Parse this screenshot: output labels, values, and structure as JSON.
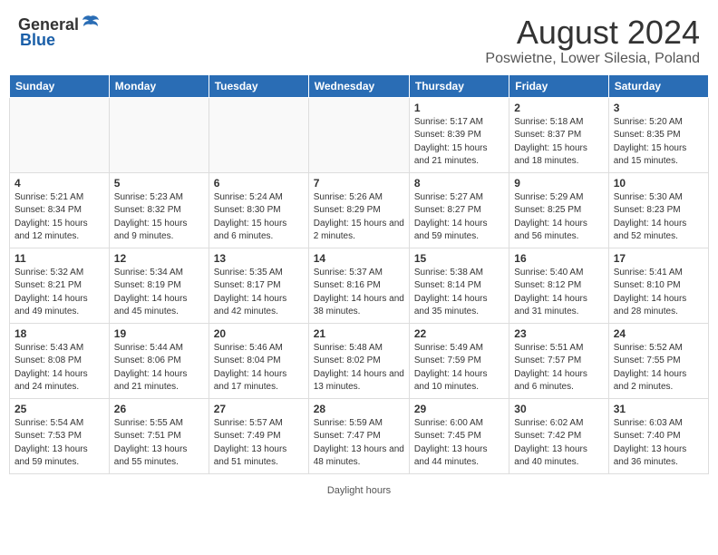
{
  "header": {
    "logo_general": "General",
    "logo_blue": "Blue",
    "title": "August 2024",
    "location": "Poswietne, Lower Silesia, Poland"
  },
  "days_of_week": [
    "Sunday",
    "Monday",
    "Tuesday",
    "Wednesday",
    "Thursday",
    "Friday",
    "Saturday"
  ],
  "footer": {
    "daylight_label": "Daylight hours"
  },
  "weeks": [
    [
      {
        "day": "",
        "sunrise": "",
        "sunset": "",
        "daylight": "",
        "empty": true
      },
      {
        "day": "",
        "sunrise": "",
        "sunset": "",
        "daylight": "",
        "empty": true
      },
      {
        "day": "",
        "sunrise": "",
        "sunset": "",
        "daylight": "",
        "empty": true
      },
      {
        "day": "",
        "sunrise": "",
        "sunset": "",
        "daylight": "",
        "empty": true
      },
      {
        "day": "1",
        "sunrise": "Sunrise: 5:17 AM",
        "sunset": "Sunset: 8:39 PM",
        "daylight": "Daylight: 15 hours and 21 minutes.",
        "empty": false
      },
      {
        "day": "2",
        "sunrise": "Sunrise: 5:18 AM",
        "sunset": "Sunset: 8:37 PM",
        "daylight": "Daylight: 15 hours and 18 minutes.",
        "empty": false
      },
      {
        "day": "3",
        "sunrise": "Sunrise: 5:20 AM",
        "sunset": "Sunset: 8:35 PM",
        "daylight": "Daylight: 15 hours and 15 minutes.",
        "empty": false
      }
    ],
    [
      {
        "day": "4",
        "sunrise": "Sunrise: 5:21 AM",
        "sunset": "Sunset: 8:34 PM",
        "daylight": "Daylight: 15 hours and 12 minutes.",
        "empty": false
      },
      {
        "day": "5",
        "sunrise": "Sunrise: 5:23 AM",
        "sunset": "Sunset: 8:32 PM",
        "daylight": "Daylight: 15 hours and 9 minutes.",
        "empty": false
      },
      {
        "day": "6",
        "sunrise": "Sunrise: 5:24 AM",
        "sunset": "Sunset: 8:30 PM",
        "daylight": "Daylight: 15 hours and 6 minutes.",
        "empty": false
      },
      {
        "day": "7",
        "sunrise": "Sunrise: 5:26 AM",
        "sunset": "Sunset: 8:29 PM",
        "daylight": "Daylight: 15 hours and 2 minutes.",
        "empty": false
      },
      {
        "day": "8",
        "sunrise": "Sunrise: 5:27 AM",
        "sunset": "Sunset: 8:27 PM",
        "daylight": "Daylight: 14 hours and 59 minutes.",
        "empty": false
      },
      {
        "day": "9",
        "sunrise": "Sunrise: 5:29 AM",
        "sunset": "Sunset: 8:25 PM",
        "daylight": "Daylight: 14 hours and 56 minutes.",
        "empty": false
      },
      {
        "day": "10",
        "sunrise": "Sunrise: 5:30 AM",
        "sunset": "Sunset: 8:23 PM",
        "daylight": "Daylight: 14 hours and 52 minutes.",
        "empty": false
      }
    ],
    [
      {
        "day": "11",
        "sunrise": "Sunrise: 5:32 AM",
        "sunset": "Sunset: 8:21 PM",
        "daylight": "Daylight: 14 hours and 49 minutes.",
        "empty": false
      },
      {
        "day": "12",
        "sunrise": "Sunrise: 5:34 AM",
        "sunset": "Sunset: 8:19 PM",
        "daylight": "Daylight: 14 hours and 45 minutes.",
        "empty": false
      },
      {
        "day": "13",
        "sunrise": "Sunrise: 5:35 AM",
        "sunset": "Sunset: 8:17 PM",
        "daylight": "Daylight: 14 hours and 42 minutes.",
        "empty": false
      },
      {
        "day": "14",
        "sunrise": "Sunrise: 5:37 AM",
        "sunset": "Sunset: 8:16 PM",
        "daylight": "Daylight: 14 hours and 38 minutes.",
        "empty": false
      },
      {
        "day": "15",
        "sunrise": "Sunrise: 5:38 AM",
        "sunset": "Sunset: 8:14 PM",
        "daylight": "Daylight: 14 hours and 35 minutes.",
        "empty": false
      },
      {
        "day": "16",
        "sunrise": "Sunrise: 5:40 AM",
        "sunset": "Sunset: 8:12 PM",
        "daylight": "Daylight: 14 hours and 31 minutes.",
        "empty": false
      },
      {
        "day": "17",
        "sunrise": "Sunrise: 5:41 AM",
        "sunset": "Sunset: 8:10 PM",
        "daylight": "Daylight: 14 hours and 28 minutes.",
        "empty": false
      }
    ],
    [
      {
        "day": "18",
        "sunrise": "Sunrise: 5:43 AM",
        "sunset": "Sunset: 8:08 PM",
        "daylight": "Daylight: 14 hours and 24 minutes.",
        "empty": false
      },
      {
        "day": "19",
        "sunrise": "Sunrise: 5:44 AM",
        "sunset": "Sunset: 8:06 PM",
        "daylight": "Daylight: 14 hours and 21 minutes.",
        "empty": false
      },
      {
        "day": "20",
        "sunrise": "Sunrise: 5:46 AM",
        "sunset": "Sunset: 8:04 PM",
        "daylight": "Daylight: 14 hours and 17 minutes.",
        "empty": false
      },
      {
        "day": "21",
        "sunrise": "Sunrise: 5:48 AM",
        "sunset": "Sunset: 8:02 PM",
        "daylight": "Daylight: 14 hours and 13 minutes.",
        "empty": false
      },
      {
        "day": "22",
        "sunrise": "Sunrise: 5:49 AM",
        "sunset": "Sunset: 7:59 PM",
        "daylight": "Daylight: 14 hours and 10 minutes.",
        "empty": false
      },
      {
        "day": "23",
        "sunrise": "Sunrise: 5:51 AM",
        "sunset": "Sunset: 7:57 PM",
        "daylight": "Daylight: 14 hours and 6 minutes.",
        "empty": false
      },
      {
        "day": "24",
        "sunrise": "Sunrise: 5:52 AM",
        "sunset": "Sunset: 7:55 PM",
        "daylight": "Daylight: 14 hours and 2 minutes.",
        "empty": false
      }
    ],
    [
      {
        "day": "25",
        "sunrise": "Sunrise: 5:54 AM",
        "sunset": "Sunset: 7:53 PM",
        "daylight": "Daylight: 13 hours and 59 minutes.",
        "empty": false
      },
      {
        "day": "26",
        "sunrise": "Sunrise: 5:55 AM",
        "sunset": "Sunset: 7:51 PM",
        "daylight": "Daylight: 13 hours and 55 minutes.",
        "empty": false
      },
      {
        "day": "27",
        "sunrise": "Sunrise: 5:57 AM",
        "sunset": "Sunset: 7:49 PM",
        "daylight": "Daylight: 13 hours and 51 minutes.",
        "empty": false
      },
      {
        "day": "28",
        "sunrise": "Sunrise: 5:59 AM",
        "sunset": "Sunset: 7:47 PM",
        "daylight": "Daylight: 13 hours and 48 minutes.",
        "empty": false
      },
      {
        "day": "29",
        "sunrise": "Sunrise: 6:00 AM",
        "sunset": "Sunset: 7:45 PM",
        "daylight": "Daylight: 13 hours and 44 minutes.",
        "empty": false
      },
      {
        "day": "30",
        "sunrise": "Sunrise: 6:02 AM",
        "sunset": "Sunset: 7:42 PM",
        "daylight": "Daylight: 13 hours and 40 minutes.",
        "empty": false
      },
      {
        "day": "31",
        "sunrise": "Sunrise: 6:03 AM",
        "sunset": "Sunset: 7:40 PM",
        "daylight": "Daylight: 13 hours and 36 minutes.",
        "empty": false
      }
    ]
  ]
}
